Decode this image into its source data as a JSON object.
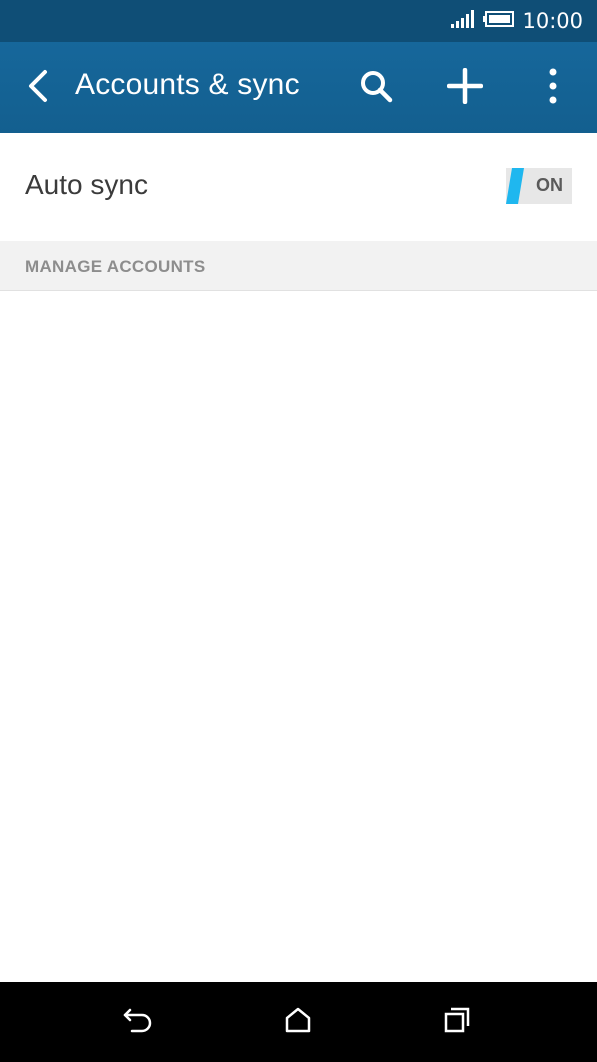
{
  "status_bar": {
    "time": "10:00",
    "icons": [
      "signal-icon",
      "battery-icon"
    ]
  },
  "app_bar": {
    "title": "Accounts & sync",
    "icons": [
      "back-arrow-icon",
      "search-icon",
      "add-icon",
      "more-vert-icon"
    ]
  },
  "settings": {
    "auto_sync": {
      "label": "Auto sync",
      "toggle_state": "ON"
    }
  },
  "manage_accounts": {
    "header": "MANAGE ACCOUNTS",
    "accounts": []
  },
  "nav_bar": {
    "icons": [
      "back-icon",
      "home-icon",
      "recent-apps-icon"
    ]
  },
  "colors": {
    "status_bar_bg": "#0f4e76",
    "app_bar_bg": "#135f8f",
    "toggle_accent": "#1fb7ef",
    "section_header_bg": "#f2f2f2"
  }
}
